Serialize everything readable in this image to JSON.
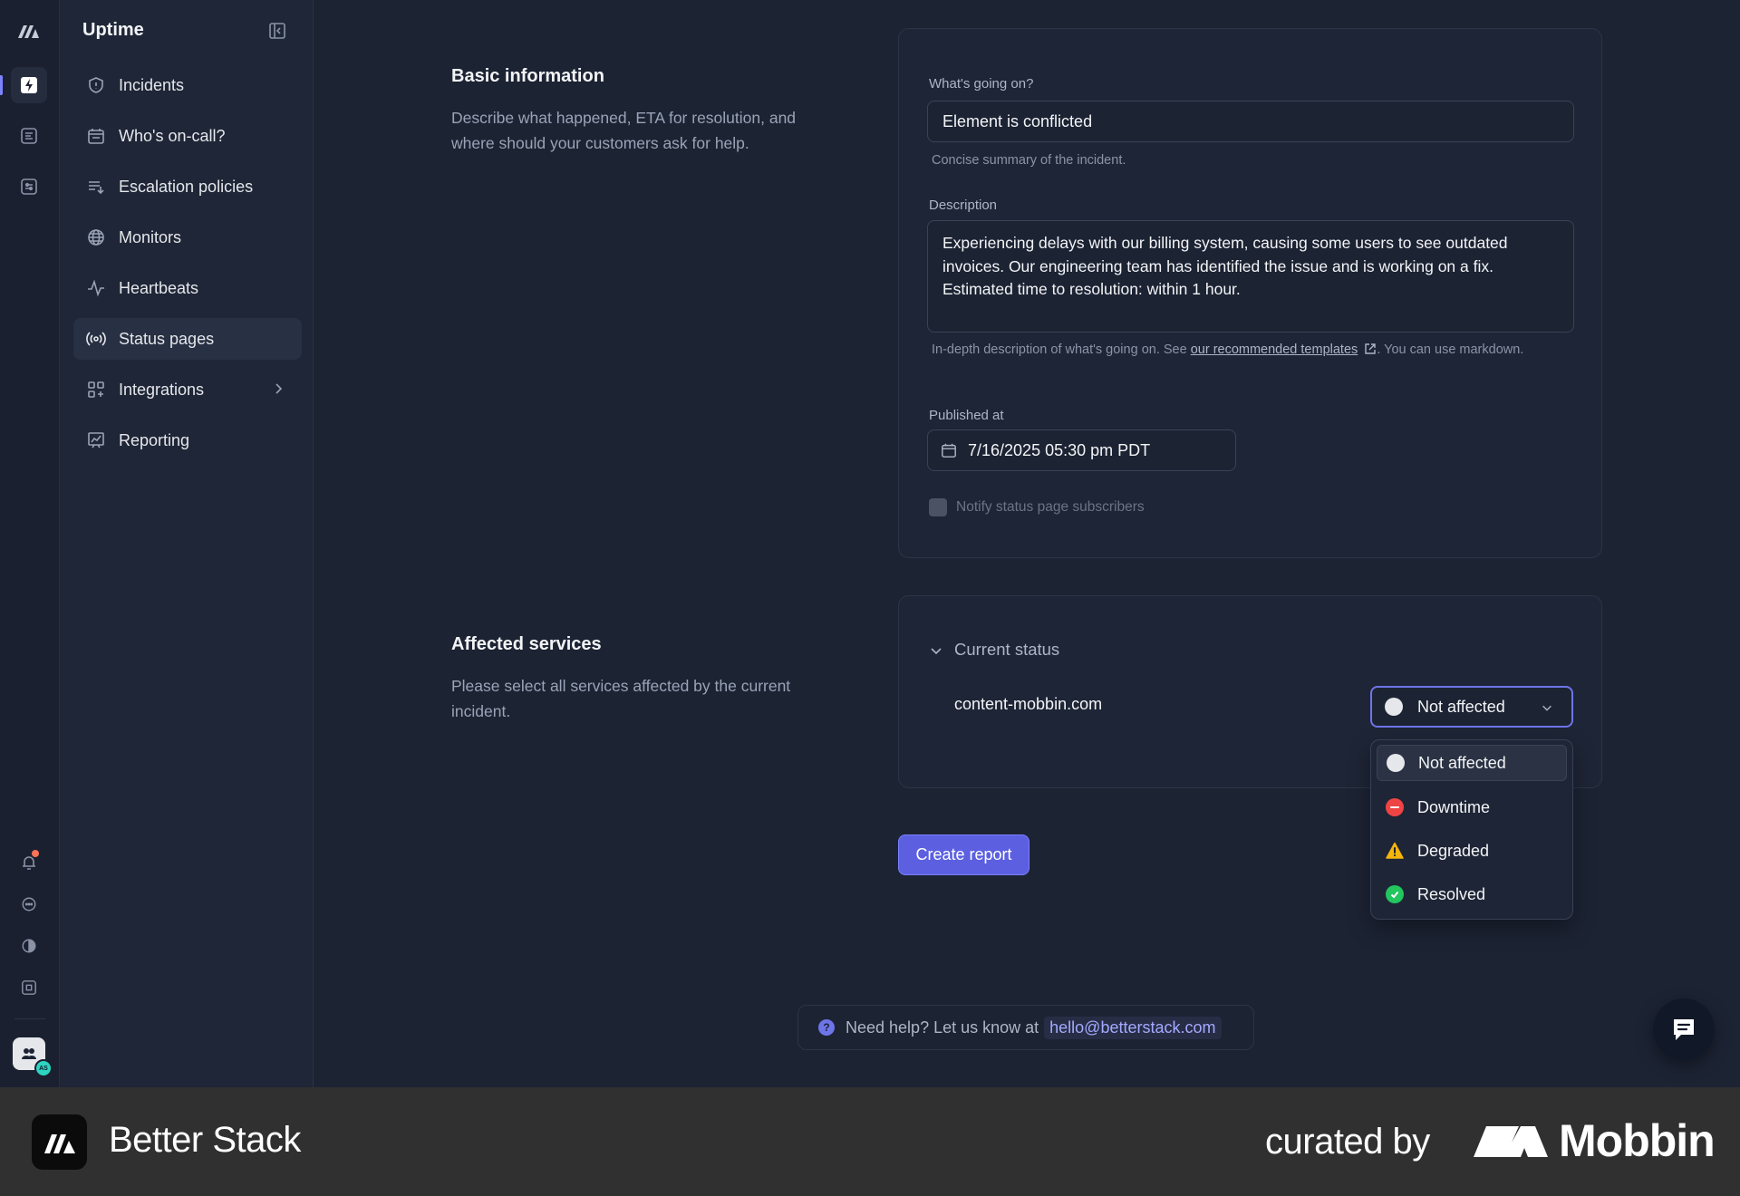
{
  "app": {
    "title": "Uptime"
  },
  "sidebar": {
    "items": [
      {
        "label": "Incidents",
        "icon": "shield-icon"
      },
      {
        "label": "Who's on-call?",
        "icon": "calendar-icon"
      },
      {
        "label": "Escalation policies",
        "icon": "list-arrow-icon"
      },
      {
        "label": "Monitors",
        "icon": "globe-icon"
      },
      {
        "label": "Heartbeats",
        "icon": "pulse-icon"
      },
      {
        "label": "Status pages",
        "icon": "broadcast-icon",
        "active": true
      },
      {
        "label": "Integrations",
        "icon": "grid-plus-icon",
        "has_submenu": true
      },
      {
        "label": "Reporting",
        "icon": "chart-board-icon"
      }
    ]
  },
  "basic_info": {
    "title": "Basic information",
    "description": "Describe what happened, ETA for resolution, and where should your customers ask for help.",
    "summary_label": "What's going on?",
    "summary_value": "Element is conflicted",
    "summary_help": "Concise summary of the incident.",
    "description_label": "Description",
    "description_value": "Experiencing delays with our billing system, causing some users to see outdated invoices. Our engineering team has identified the issue and is working on a fix. Estimated time to resolution: within 1 hour.",
    "description_help_prefix": "In-depth description of what's going on. See ",
    "description_help_link": "our recommended templates",
    "description_help_suffix": ". You can use markdown.",
    "published_label": "Published at",
    "published_value": "7/16/2025 05:30 pm PDT",
    "notify_label": "Notify status page subscribers"
  },
  "affected": {
    "title": "Affected services",
    "description": "Please select all services affected by the current incident.",
    "current_status_label": "Current status",
    "service_name": "content-mobbin.com",
    "selected_status": "Not affected",
    "options": [
      {
        "label": "Not affected",
        "icon": "circle-white-icon"
      },
      {
        "label": "Downtime",
        "icon": "minus-circle-icon"
      },
      {
        "label": "Degraded",
        "icon": "warning-triangle-icon"
      },
      {
        "label": "Resolved",
        "icon": "check-circle-icon"
      }
    ]
  },
  "actions": {
    "create_label": "Create report"
  },
  "help": {
    "text": "Need help? Let us know at",
    "email": "hello@betterstack.com"
  },
  "banner": {
    "brand": "Better Stack",
    "curated": "curated by",
    "mobbin": "Mobbin"
  },
  "colors": {
    "accent": "#5b5fe0",
    "downtime": "#ef4444",
    "degraded": "#f5b50b",
    "resolved": "#22c55e"
  }
}
